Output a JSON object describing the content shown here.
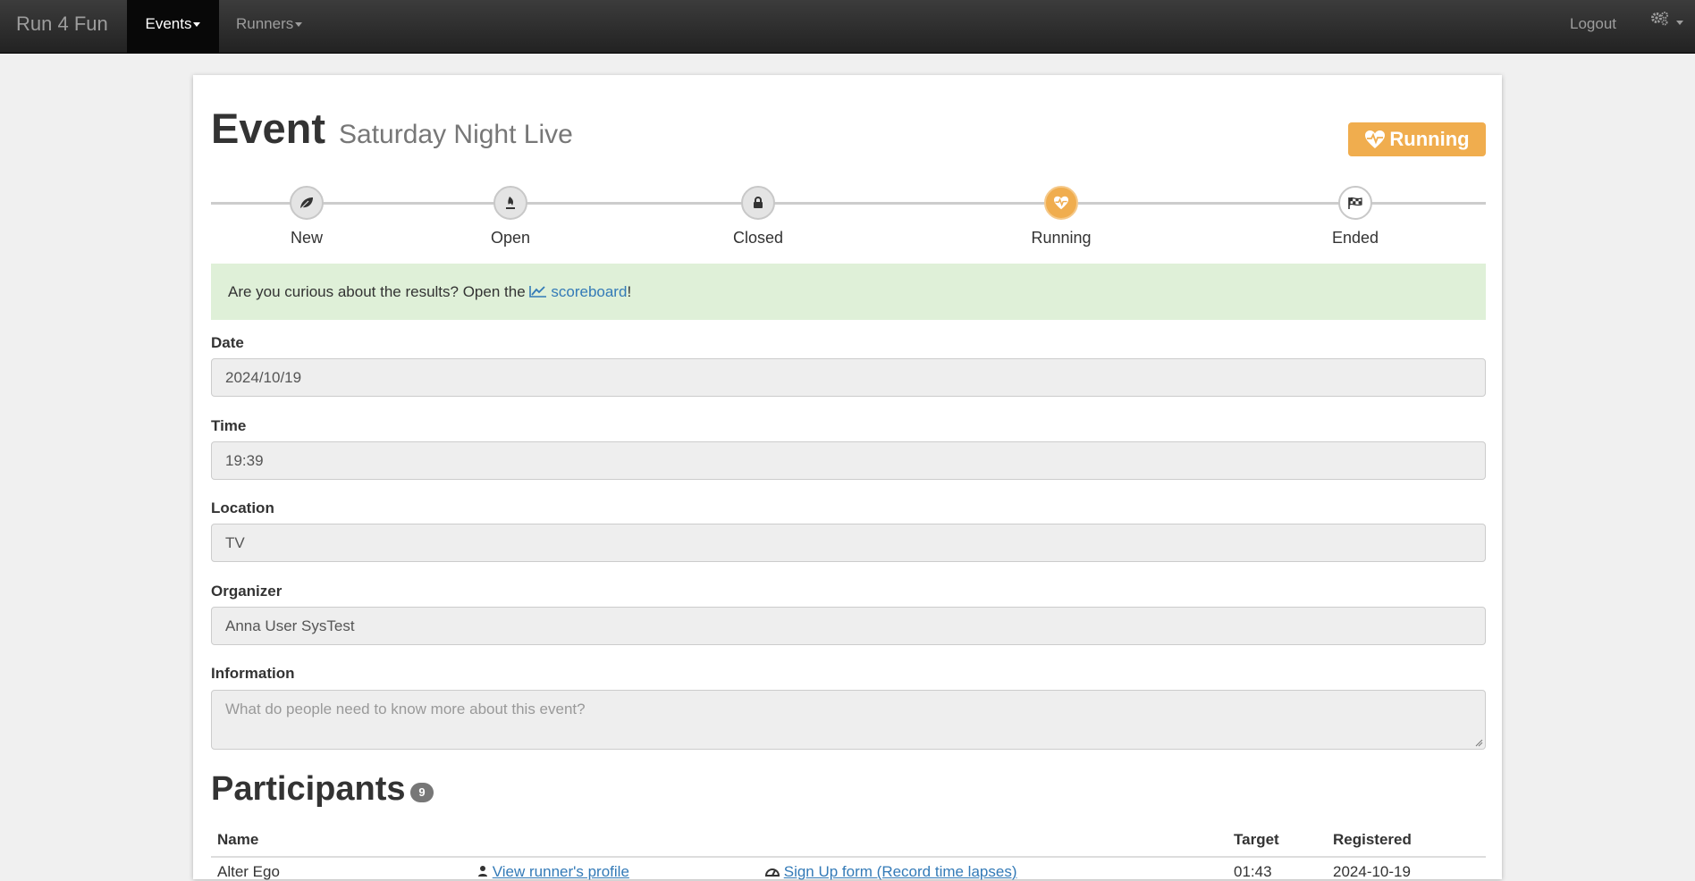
{
  "nav": {
    "brand": "Run 4 Fun",
    "events": "Events",
    "runners": "Runners",
    "logout": "Logout",
    "settings_icon": "gears-icon"
  },
  "header": {
    "title": "Event",
    "subtitle": "Saturday Night Live",
    "status": "Running",
    "status_icon": "heartbeat-icon",
    "status_color": "#f0ad4e"
  },
  "timeline": {
    "steps": [
      {
        "label": "New",
        "icon": "leaf-icon"
      },
      {
        "label": "Open",
        "icon": "fire-icon"
      },
      {
        "label": "Closed",
        "icon": "lock-icon"
      },
      {
        "label": "Running",
        "icon": "heartbeat-icon"
      },
      {
        "label": "Ended",
        "icon": "checkered-flag-icon"
      }
    ],
    "active": "Running"
  },
  "alert": {
    "text_before": "Are you curious about the results? Open the ",
    "link": "scoreboard",
    "text_after": "!",
    "color": "#dff0d8"
  },
  "form": {
    "date_label": "Date",
    "date_value": "2024/10/19",
    "time_label": "Time",
    "time_value": "19:39",
    "location_label": "Location",
    "location_value": "TV",
    "organizer_label": "Organizer",
    "organizer_value": "Anna User SysTest",
    "information_label": "Information",
    "information_placeholder": "What do people need to know more about this event?"
  },
  "participants": {
    "title": "Participants",
    "count": "9",
    "columns": [
      "Name",
      "",
      "",
      "Target",
      "Registered"
    ],
    "rows": [
      {
        "name": "Alter Ego",
        "profile_link": "View runner's profile",
        "signup_link": "Sign Up form (Record time lapses)",
        "target": "01:43",
        "registered": "2024-10-19"
      }
    ]
  }
}
